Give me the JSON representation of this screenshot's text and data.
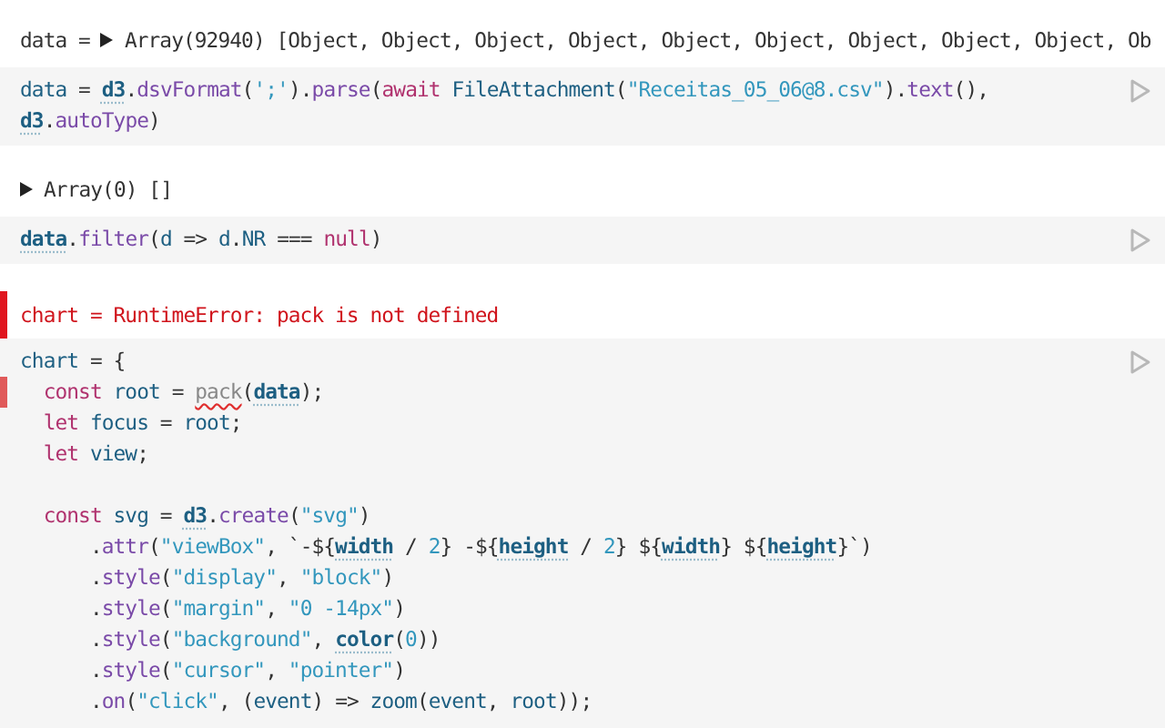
{
  "cells": [
    {
      "output": {
        "kind": "value",
        "label": "data =",
        "expanded": false,
        "value": "Array(92940) [Object, Object, Object, Object, Object, Object, Object, Object, Object, Ob"
      },
      "code": [
        {
          "kind": "code",
          "flagged": false,
          "tokens": [
            {
              "kind": "var",
              "text": "data"
            },
            {
              "kind": "plain",
              "text": " = "
            },
            {
              "kind": "global",
              "text": "d3"
            },
            {
              "kind": "plain",
              "text": "."
            },
            {
              "kind": "fn",
              "text": "dsvFormat"
            },
            {
              "kind": "plain",
              "text": "("
            },
            {
              "kind": "str",
              "text": "';'"
            },
            {
              "kind": "plain",
              "text": ")."
            },
            {
              "kind": "fn",
              "text": "parse"
            },
            {
              "kind": "plain",
              "text": "("
            },
            {
              "kind": "kw",
              "text": "await "
            },
            {
              "kind": "var",
              "text": "FileAttachment"
            },
            {
              "kind": "plain",
              "text": "("
            },
            {
              "kind": "str",
              "text": "\"Receitas_05_06@8.csv\""
            },
            {
              "kind": "plain",
              "text": ")."
            },
            {
              "kind": "fn",
              "text": "text"
            },
            {
              "kind": "plain",
              "text": "(),"
            }
          ]
        },
        {
          "kind": "code",
          "flagged": false,
          "tokens": [
            {
              "kind": "global",
              "text": "d3"
            },
            {
              "kind": "plain",
              "text": "."
            },
            {
              "kind": "fn",
              "text": "autoType"
            },
            {
              "kind": "plain",
              "text": ")"
            }
          ]
        }
      ]
    },
    {
      "output": {
        "kind": "value",
        "expanded": false,
        "value": "Array(0) []"
      },
      "code": [
        {
          "kind": "code",
          "flagged": false,
          "tokens": [
            {
              "kind": "global",
              "text": "data"
            },
            {
              "kind": "plain",
              "text": "."
            },
            {
              "kind": "fn",
              "text": "filter"
            },
            {
              "kind": "plain",
              "text": "("
            },
            {
              "kind": "var",
              "text": "d"
            },
            {
              "kind": "plain",
              "text": " => "
            },
            {
              "kind": "var",
              "text": "d"
            },
            {
              "kind": "plain",
              "text": "."
            },
            {
              "kind": "var",
              "text": "NR"
            },
            {
              "kind": "plain",
              "text": " === "
            },
            {
              "kind": "kw",
              "text": "null"
            },
            {
              "kind": "plain",
              "text": ")"
            }
          ]
        }
      ]
    },
    {
      "output": {
        "kind": "error",
        "value": "chart = RuntimeError: pack is not defined"
      },
      "code": [
        {
          "kind": "code",
          "flagged": false,
          "tokens": [
            {
              "kind": "var",
              "text": "chart"
            },
            {
              "kind": "plain",
              "text": " = {"
            }
          ]
        },
        {
          "kind": "code",
          "flagged": true,
          "tokens": [
            {
              "kind": "kw",
              "text": "  const "
            },
            {
              "kind": "var",
              "text": "root"
            },
            {
              "kind": "plain",
              "text": " = "
            },
            {
              "kind": "undefined",
              "text": "pack"
            },
            {
              "kind": "plain",
              "text": "("
            },
            {
              "kind": "global",
              "text": "data"
            },
            {
              "kind": "plain",
              "text": ");"
            }
          ]
        },
        {
          "kind": "code",
          "flagged": false,
          "tokens": [
            {
              "kind": "kw",
              "text": "  let "
            },
            {
              "kind": "var",
              "text": "focus"
            },
            {
              "kind": "plain",
              "text": " = "
            },
            {
              "kind": "var",
              "text": "root"
            },
            {
              "kind": "plain",
              "text": ";"
            }
          ]
        },
        {
          "kind": "code",
          "flagged": false,
          "tokens": [
            {
              "kind": "kw",
              "text": "  let "
            },
            {
              "kind": "var",
              "text": "view"
            },
            {
              "kind": "plain",
              "text": ";"
            }
          ]
        },
        {
          "kind": "blank"
        },
        {
          "kind": "code",
          "flagged": false,
          "tokens": [
            {
              "kind": "kw",
              "text": "  const "
            },
            {
              "kind": "var",
              "text": "svg"
            },
            {
              "kind": "plain",
              "text": " = "
            },
            {
              "kind": "global",
              "text": "d3"
            },
            {
              "kind": "plain",
              "text": "."
            },
            {
              "kind": "fn",
              "text": "create"
            },
            {
              "kind": "plain",
              "text": "("
            },
            {
              "kind": "str",
              "text": "\"svg\""
            },
            {
              "kind": "plain",
              "text": ")"
            }
          ]
        },
        {
          "kind": "code",
          "flagged": false,
          "tokens": [
            {
              "kind": "plain",
              "text": "      ."
            },
            {
              "kind": "fn",
              "text": "attr"
            },
            {
              "kind": "plain",
              "text": "("
            },
            {
              "kind": "str",
              "text": "\"viewBox\""
            },
            {
              "kind": "plain",
              "text": ", `-${"
            },
            {
              "kind": "global",
              "text": "width"
            },
            {
              "kind": "plain",
              "text": " / "
            },
            {
              "kind": "num",
              "text": "2"
            },
            {
              "kind": "plain",
              "text": "} -${"
            },
            {
              "kind": "global",
              "text": "height"
            },
            {
              "kind": "plain",
              "text": " / "
            },
            {
              "kind": "num",
              "text": "2"
            },
            {
              "kind": "plain",
              "text": "} ${"
            },
            {
              "kind": "global",
              "text": "width"
            },
            {
              "kind": "plain",
              "text": "} ${"
            },
            {
              "kind": "global",
              "text": "height"
            },
            {
              "kind": "plain",
              "text": "}`)"
            }
          ]
        },
        {
          "kind": "code",
          "flagged": false,
          "tokens": [
            {
              "kind": "plain",
              "text": "      ."
            },
            {
              "kind": "fn",
              "text": "style"
            },
            {
              "kind": "plain",
              "text": "("
            },
            {
              "kind": "str",
              "text": "\"display\""
            },
            {
              "kind": "plain",
              "text": ", "
            },
            {
              "kind": "str",
              "text": "\"block\""
            },
            {
              "kind": "plain",
              "text": ")"
            }
          ]
        },
        {
          "kind": "code",
          "flagged": false,
          "tokens": [
            {
              "kind": "plain",
              "text": "      ."
            },
            {
              "kind": "fn",
              "text": "style"
            },
            {
              "kind": "plain",
              "text": "("
            },
            {
              "kind": "str",
              "text": "\"margin\""
            },
            {
              "kind": "plain",
              "text": ", "
            },
            {
              "kind": "str",
              "text": "\"0 -14px\""
            },
            {
              "kind": "plain",
              "text": ")"
            }
          ]
        },
        {
          "kind": "code",
          "flagged": false,
          "tokens": [
            {
              "kind": "plain",
              "text": "      ."
            },
            {
              "kind": "fn",
              "text": "style"
            },
            {
              "kind": "plain",
              "text": "("
            },
            {
              "kind": "str",
              "text": "\"background\""
            },
            {
              "kind": "plain",
              "text": ", "
            },
            {
              "kind": "global",
              "text": "color"
            },
            {
              "kind": "plain",
              "text": "("
            },
            {
              "kind": "num",
              "text": "0"
            },
            {
              "kind": "plain",
              "text": "))"
            }
          ]
        },
        {
          "kind": "code",
          "flagged": false,
          "tokens": [
            {
              "kind": "plain",
              "text": "      ."
            },
            {
              "kind": "fn",
              "text": "style"
            },
            {
              "kind": "plain",
              "text": "("
            },
            {
              "kind": "str",
              "text": "\"cursor\""
            },
            {
              "kind": "plain",
              "text": ", "
            },
            {
              "kind": "str",
              "text": "\"pointer\""
            },
            {
              "kind": "plain",
              "text": ")"
            }
          ]
        },
        {
          "kind": "code",
          "flagged": false,
          "tokens": [
            {
              "kind": "plain",
              "text": "      ."
            },
            {
              "kind": "fn",
              "text": "on"
            },
            {
              "kind": "plain",
              "text": "("
            },
            {
              "kind": "str",
              "text": "\"click\""
            },
            {
              "kind": "plain",
              "text": ", ("
            },
            {
              "kind": "var",
              "text": "event"
            },
            {
              "kind": "plain",
              "text": ") => "
            },
            {
              "kind": "var",
              "text": "zoom"
            },
            {
              "kind": "plain",
              "text": "("
            },
            {
              "kind": "var",
              "text": "event"
            },
            {
              "kind": "plain",
              "text": ", "
            },
            {
              "kind": "var",
              "text": "root"
            },
            {
              "kind": "plain",
              "text": "));"
            }
          ]
        }
      ]
    }
  ]
}
